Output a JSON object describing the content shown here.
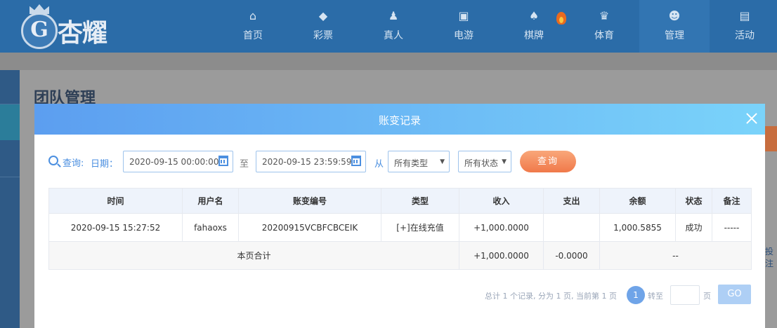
{
  "brand": {
    "crest": "G",
    "name": "杏耀"
  },
  "nav": [
    {
      "label": "首页",
      "icon": "⌂"
    },
    {
      "label": "彩票",
      "icon": "◆"
    },
    {
      "label": "真人",
      "icon": "♟"
    },
    {
      "label": "电游",
      "icon": "▣"
    },
    {
      "label": "棋牌",
      "icon": "♠"
    },
    {
      "label": "体育",
      "icon": "♛"
    },
    {
      "label": "管理",
      "icon": "☻"
    },
    {
      "label": "活动",
      "icon": "▤"
    }
  ],
  "background": {
    "page_title": "团队管理",
    "side_link": "投注"
  },
  "modal": {
    "title": "账变记录",
    "filter": {
      "query_label": "查询:",
      "date_label": "日期：",
      "start_date": "2020-09-15 00:00:00",
      "to_label": "至",
      "end_date": "2020-09-15 23:59:59",
      "from_label": "从",
      "type_select": "所有类型",
      "status_select": "所有状态",
      "query_button": "查询"
    },
    "table": {
      "columns": [
        "时间",
        "用户名",
        "账变编号",
        "类型",
        "收入",
        "支出",
        "余额",
        "状态",
        "备注"
      ],
      "rows": [
        [
          "2020-09-15 15:27:52",
          "fahaoxs",
          "20200915VCBFCBCEIK",
          "[+]在线充值",
          "+1,000.0000",
          "",
          "1,000.5855",
          "成功",
          "-----"
        ]
      ],
      "summary": {
        "label": "本页合计",
        "income": "+1,000.0000",
        "expense": "-0.0000",
        "rest": "--"
      }
    },
    "pager": {
      "info": "总计 1 个记录, 分为 1 页, 当前第 1 页",
      "current": "1",
      "goto_label": "转至",
      "page_label": "页",
      "go_button": "GO"
    }
  },
  "colors": {
    "nav_bg": "#2b6ca8",
    "modal_header_start": "#5c9ef0",
    "modal_header_end": "#7ad3fa",
    "query_button": "#f0794a",
    "income": "#3f8c1c"
  }
}
